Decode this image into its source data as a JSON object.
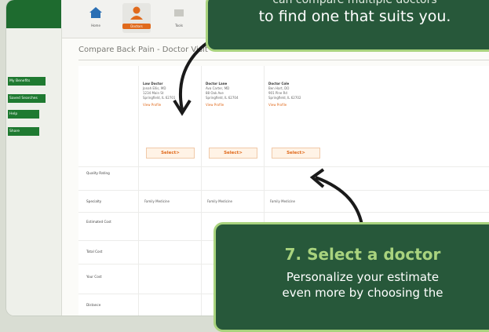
{
  "topnav": [
    {
      "label": "Home",
      "icon": "house-icon"
    },
    {
      "label": "Doctors",
      "icon": "person-icon"
    },
    {
      "label": "Tools",
      "icon": "tools-icon"
    }
  ],
  "sidebar": [
    {
      "label": "My Benefits"
    },
    {
      "label": "Saved Searches"
    },
    {
      "label": "Help"
    },
    {
      "label": "Share"
    }
  ],
  "breadcrumb": "Compare Back Pain - Doctor Visit",
  "table": {
    "columns": [
      {
        "name": "Low Doctor",
        "lines": [
          "Jonah Ellis, MD",
          "1234 Main St",
          "Springfield, IL 62701"
        ],
        "link": "View Profile"
      },
      {
        "name": "Doctor Lane",
        "lines": [
          "Ava Carter, MD",
          "88 Oak Ave",
          "Springfield, IL 62704"
        ],
        "link": "View Profile"
      },
      {
        "name": "Doctor Cole",
        "lines": [
          "Ben Hart, DO",
          "901 Pine Rd",
          "Springfield, IL 62702"
        ],
        "link": "View Profile"
      }
    ],
    "select_label": "Select>",
    "rows": [
      {
        "label": "Quality Rating",
        "values": [
          "",
          "",
          ""
        ]
      },
      {
        "label": "Specialty",
        "values": [
          "Family Medicine",
          "Family Medicine",
          "Family Medicine"
        ]
      },
      {
        "label": "Estimated Cost",
        "values": [
          "",
          "",
          ""
        ]
      },
      {
        "label": "Total Cost",
        "values": [
          "",
          "",
          ""
        ]
      },
      {
        "label": "Your Cost",
        "values": [
          "",
          "",
          ""
        ]
      },
      {
        "label": "Distance",
        "values": [
          "",
          "",
          ""
        ]
      }
    ]
  },
  "callouts": {
    "top_line1": "can compare multiple doctors",
    "top_line2": "to find one that suits you.",
    "step_title": "7. Select a doctor",
    "body_line1": "Personalize your estimate",
    "body_line2": "even more by choosing the"
  }
}
